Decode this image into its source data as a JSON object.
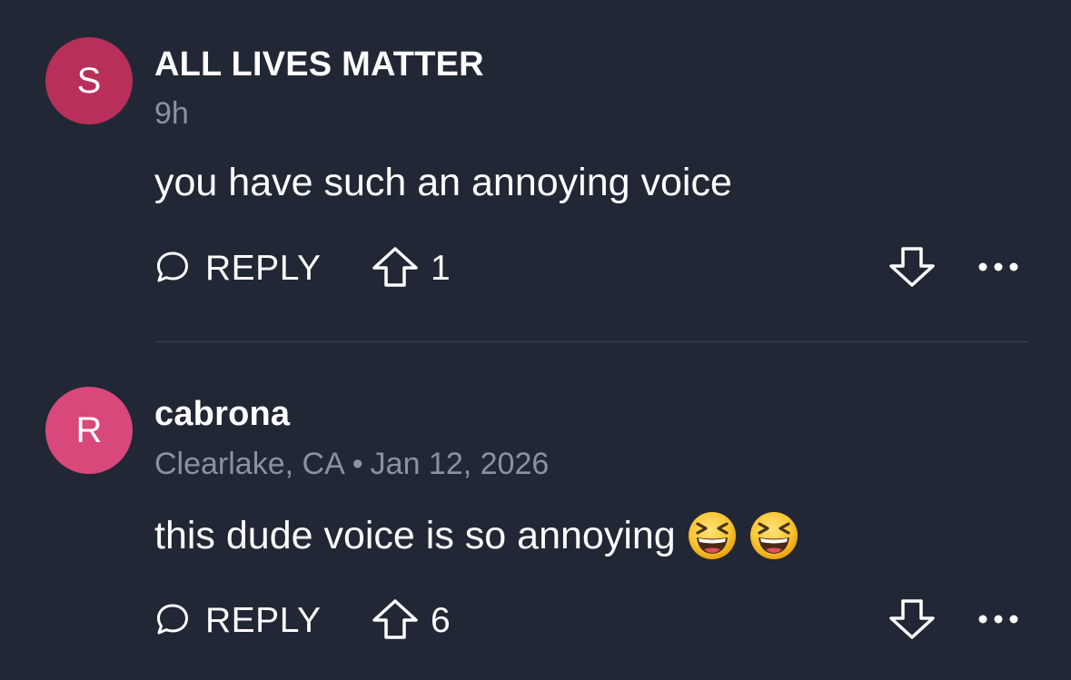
{
  "comments": [
    {
      "avatar_letter": "S",
      "avatar_color": "#b8305a",
      "username": "ALL LIVES MATTER",
      "time": "9h",
      "text": "you have such an annoying voice",
      "reply_label": "REPLY",
      "upvotes": "1"
    },
    {
      "avatar_letter": "R",
      "avatar_color": "#d9487a",
      "username": "cabrona",
      "location": "Clearlake, CA",
      "separator": "•",
      "date": "Jan 12, 2026",
      "text": "this dude voice is so annoying",
      "emojis": [
        "grinning-squinting-face-emoji",
        "grinning-squinting-face-emoji"
      ],
      "reply_label": "REPLY",
      "upvotes": "6"
    }
  ],
  "icons": {
    "reply": "speech-bubble-icon",
    "upvote": "arrow-up-outline-icon",
    "downvote": "arrow-down-outline-icon",
    "more": "ellipsis-icon"
  },
  "colors": {
    "background": "#222735",
    "text": "#ffffff",
    "meta_text": "#8b91a0",
    "divider": "#3a4050"
  }
}
